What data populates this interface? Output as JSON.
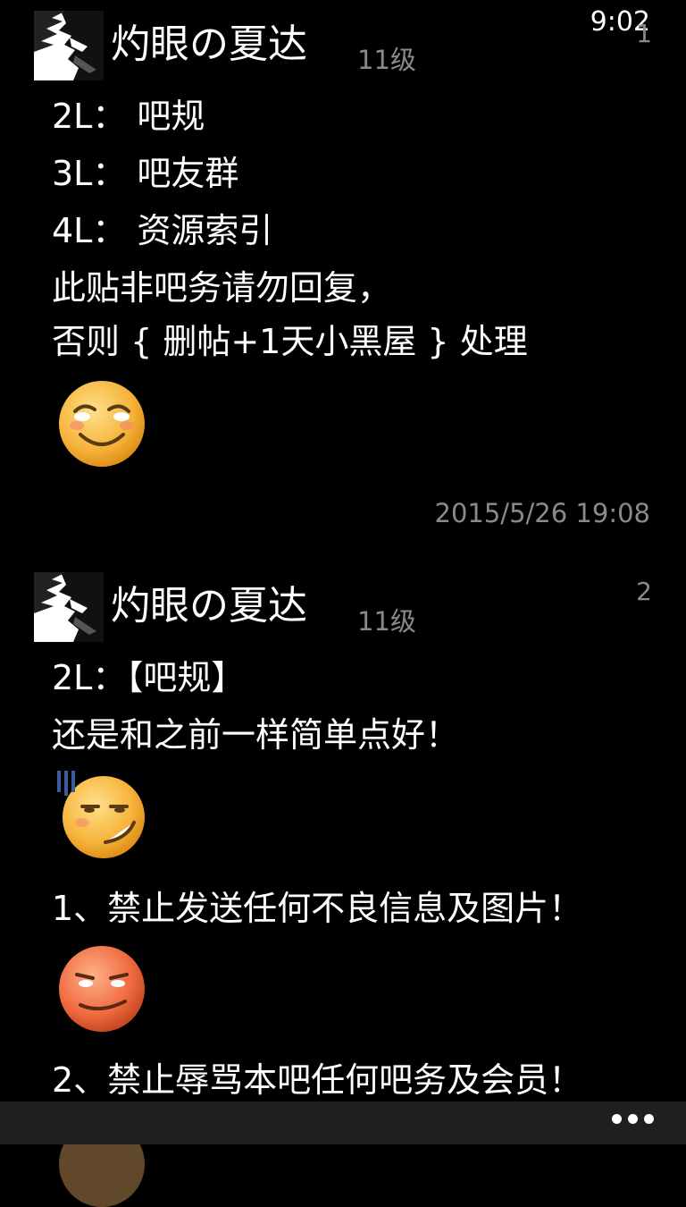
{
  "status_bar": {
    "time": "9:02"
  },
  "posts": [
    {
      "username": "灼眼の夏达",
      "level": "11级",
      "floor": "1",
      "lines": [
        "2L： 吧规",
        "3L： 吧友群",
        "4L： 资源索引",
        "此贴非吧务请勿回复，",
        "否则 { 删帖+1天小黑屋 } 处理"
      ],
      "timestamp": "2015/5/26 19:08",
      "emoticons": [
        "smile-emoticon"
      ]
    },
    {
      "username": "灼眼の夏达",
      "level": "11级",
      "floor": "2",
      "lines": [
        "2L：【吧规】",
        "还是和之前一样简单点好！",
        "1、禁止发送任何不良信息及图片！",
        "2、禁止辱骂本吧任何吧务及会员！"
      ],
      "emoticons": [
        "sweat-smirk-emoticon",
        "red-smirk-emoticon",
        "partial-emoticon"
      ]
    }
  ],
  "app_bar": {
    "icon": "more-dots-icon"
  },
  "colors": {
    "background": "#000000",
    "text": "#ffffff",
    "secondary_text": "#8a8a8a",
    "app_bar": "#1f1f1f",
    "emoticon_yellow": "#f6b33a",
    "emoticon_red": "#ef6a3e"
  }
}
